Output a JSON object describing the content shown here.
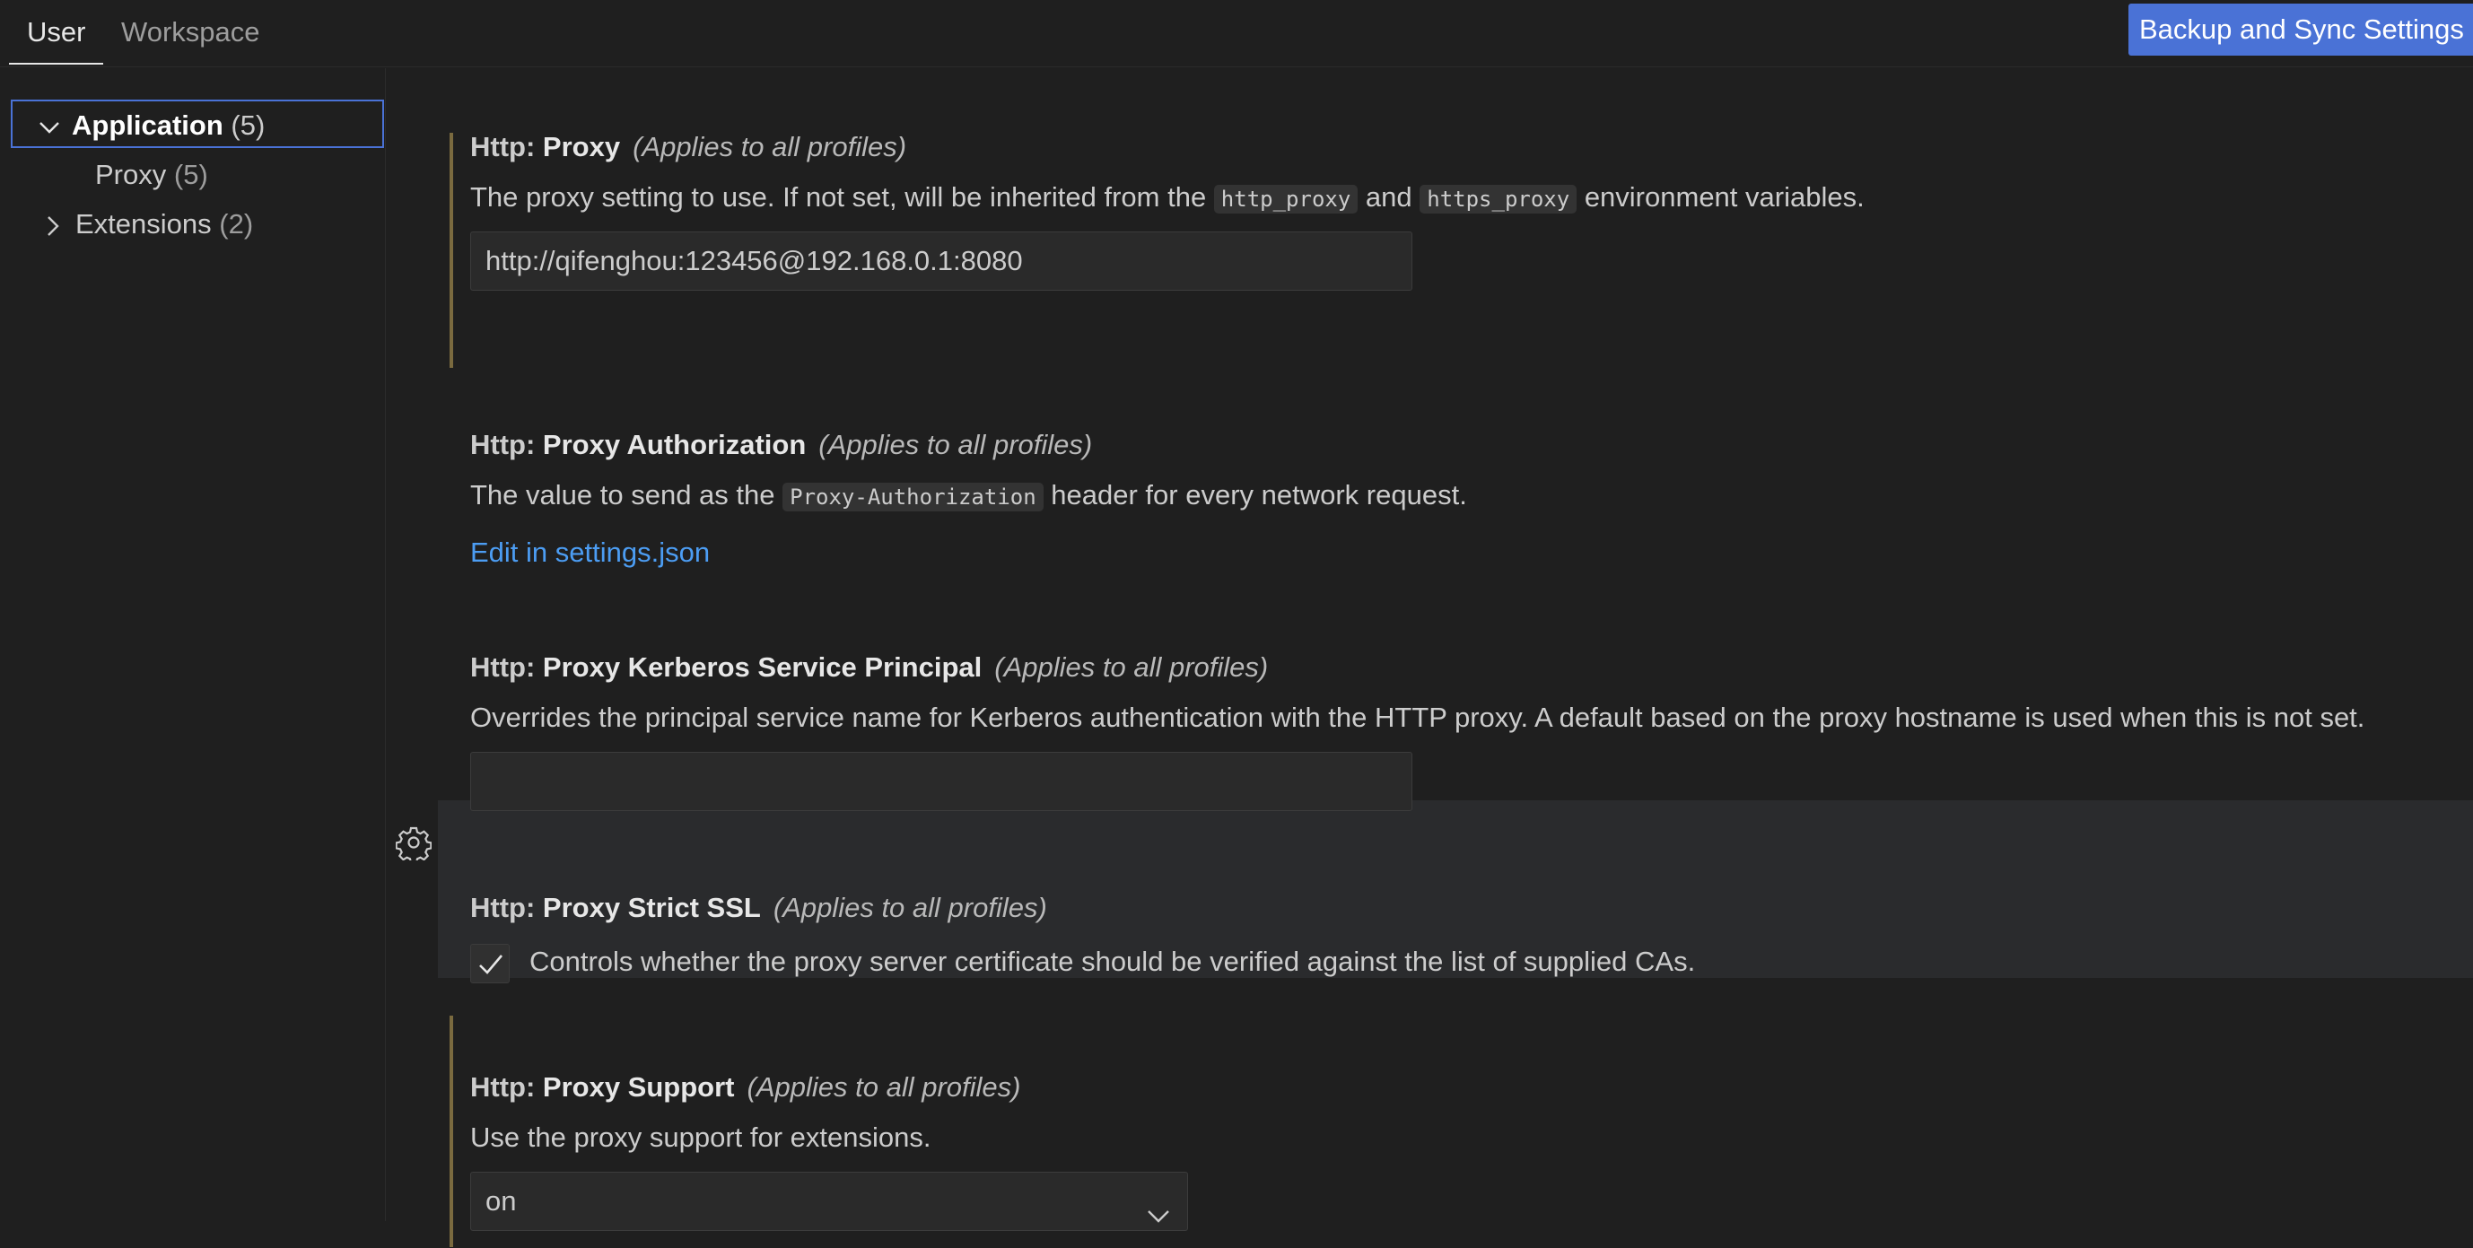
{
  "tabs": {
    "user": "User",
    "workspace": "Workspace"
  },
  "backup_button": "Backup and Sync Settings",
  "toc": {
    "application": {
      "label": "Application",
      "count": "(5)"
    },
    "proxy": {
      "label": "Proxy",
      "count": "(5)"
    },
    "extensions": {
      "label": "Extensions",
      "count": "(2)"
    }
  },
  "settings": {
    "proxy": {
      "category": "Http: ",
      "name": "Proxy",
      "scope": "(Applies to all profiles)",
      "desc_before": "The proxy setting to use. If not set, will be inherited from the ",
      "code1": "http_proxy",
      "desc_mid": " and ",
      "code2": "https_proxy",
      "desc_after": " environment variables.",
      "value": "http://qifenghou:123456@192.168.0.1:8080"
    },
    "proxy_authorization": {
      "category": "Http: ",
      "name": "Proxy Authorization",
      "scope": "(Applies to all profiles)",
      "desc_before": "The value to send as the ",
      "code1": "Proxy-Authorization",
      "desc_after": " header for every network request.",
      "link": "Edit in settings.json"
    },
    "proxy_kerberos": {
      "category": "Http: ",
      "name": "Proxy Kerberos Service Principal",
      "scope": "(Applies to all profiles)",
      "desc": "Overrides the principal service name for Kerberos authentication with the HTTP proxy. A default based on the proxy hostname is used when this is not set.",
      "value": ""
    },
    "proxy_strict_ssl": {
      "category": "Http: ",
      "name": "Proxy Strict SSL",
      "scope": "(Applies to all profiles)",
      "checked": true,
      "checkbox_label": "Controls whether the proxy server certificate should be verified against the list of supplied CAs."
    },
    "proxy_support": {
      "category": "Http: ",
      "name": "Proxy Support",
      "scope": "(Applies to all profiles)",
      "desc": "Use the proxy support for extensions.",
      "value": "on"
    }
  },
  "colors": {
    "accent": "#4a72d6",
    "link": "#4c9df3",
    "modified_indicator": "#7a6a3f",
    "background": "#1f1f1f"
  }
}
